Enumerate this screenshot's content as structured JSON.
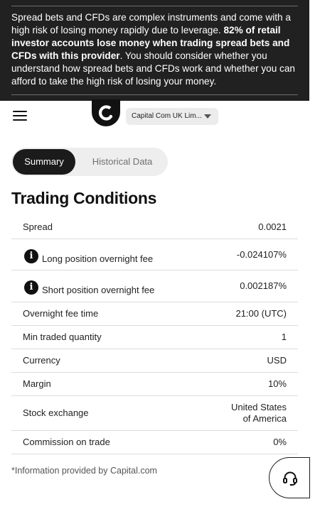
{
  "risk_warning": {
    "part1": "Spread bets and CFDs are complex instruments and come with a high risk of losing money rapidly due to leverage. ",
    "part2_bold": "82% of retail investor accounts lose money when trading spread bets and CFDs with this provider",
    "part3": ". You should consider whether you understand how spread bets and CFDs work and whether you can afford to take the high risk of losing your money."
  },
  "header": {
    "entity_selector": "Capital Com UK Lim..."
  },
  "tabs": [
    {
      "label": "Summary",
      "active": true
    },
    {
      "label": "Historical Data",
      "active": false
    }
  ],
  "section_title": "Trading Conditions",
  "conditions": [
    {
      "label": "Spread",
      "value": "0.0021",
      "info": false
    },
    {
      "label": "Long position overnight fee",
      "value": "-0.024107%",
      "info": true
    },
    {
      "label": "Short position overnight fee",
      "value": "0.002187%",
      "info": true
    },
    {
      "label": "Overnight fee time",
      "value": "21:00 (UTC)",
      "info": false
    },
    {
      "label": "Min traded quantity",
      "value": "1",
      "info": false
    },
    {
      "label": "Currency",
      "value": "USD",
      "info": false
    },
    {
      "label": "Margin",
      "value": "10%",
      "info": false
    },
    {
      "label": "Stock exchange",
      "value": "United States of America",
      "value_line1": "United States",
      "value_line2": "of America",
      "info": false
    },
    {
      "label": "Commission on trade",
      "value": "0%",
      "info": false
    }
  ],
  "footnote": "*Information provided by Capital.com",
  "icons": {
    "menu": "hamburger-menu-icon",
    "logo": "capital-com-logo",
    "info": "info-icon",
    "support": "headset-icon",
    "dropdown": "chevron-down-icon"
  },
  "colors": {
    "banner_bg": "#212121",
    "active_tab_bg": "#1b1b1b",
    "tabs_bg": "#eeeeee",
    "divider": "#dcdcdc"
  }
}
